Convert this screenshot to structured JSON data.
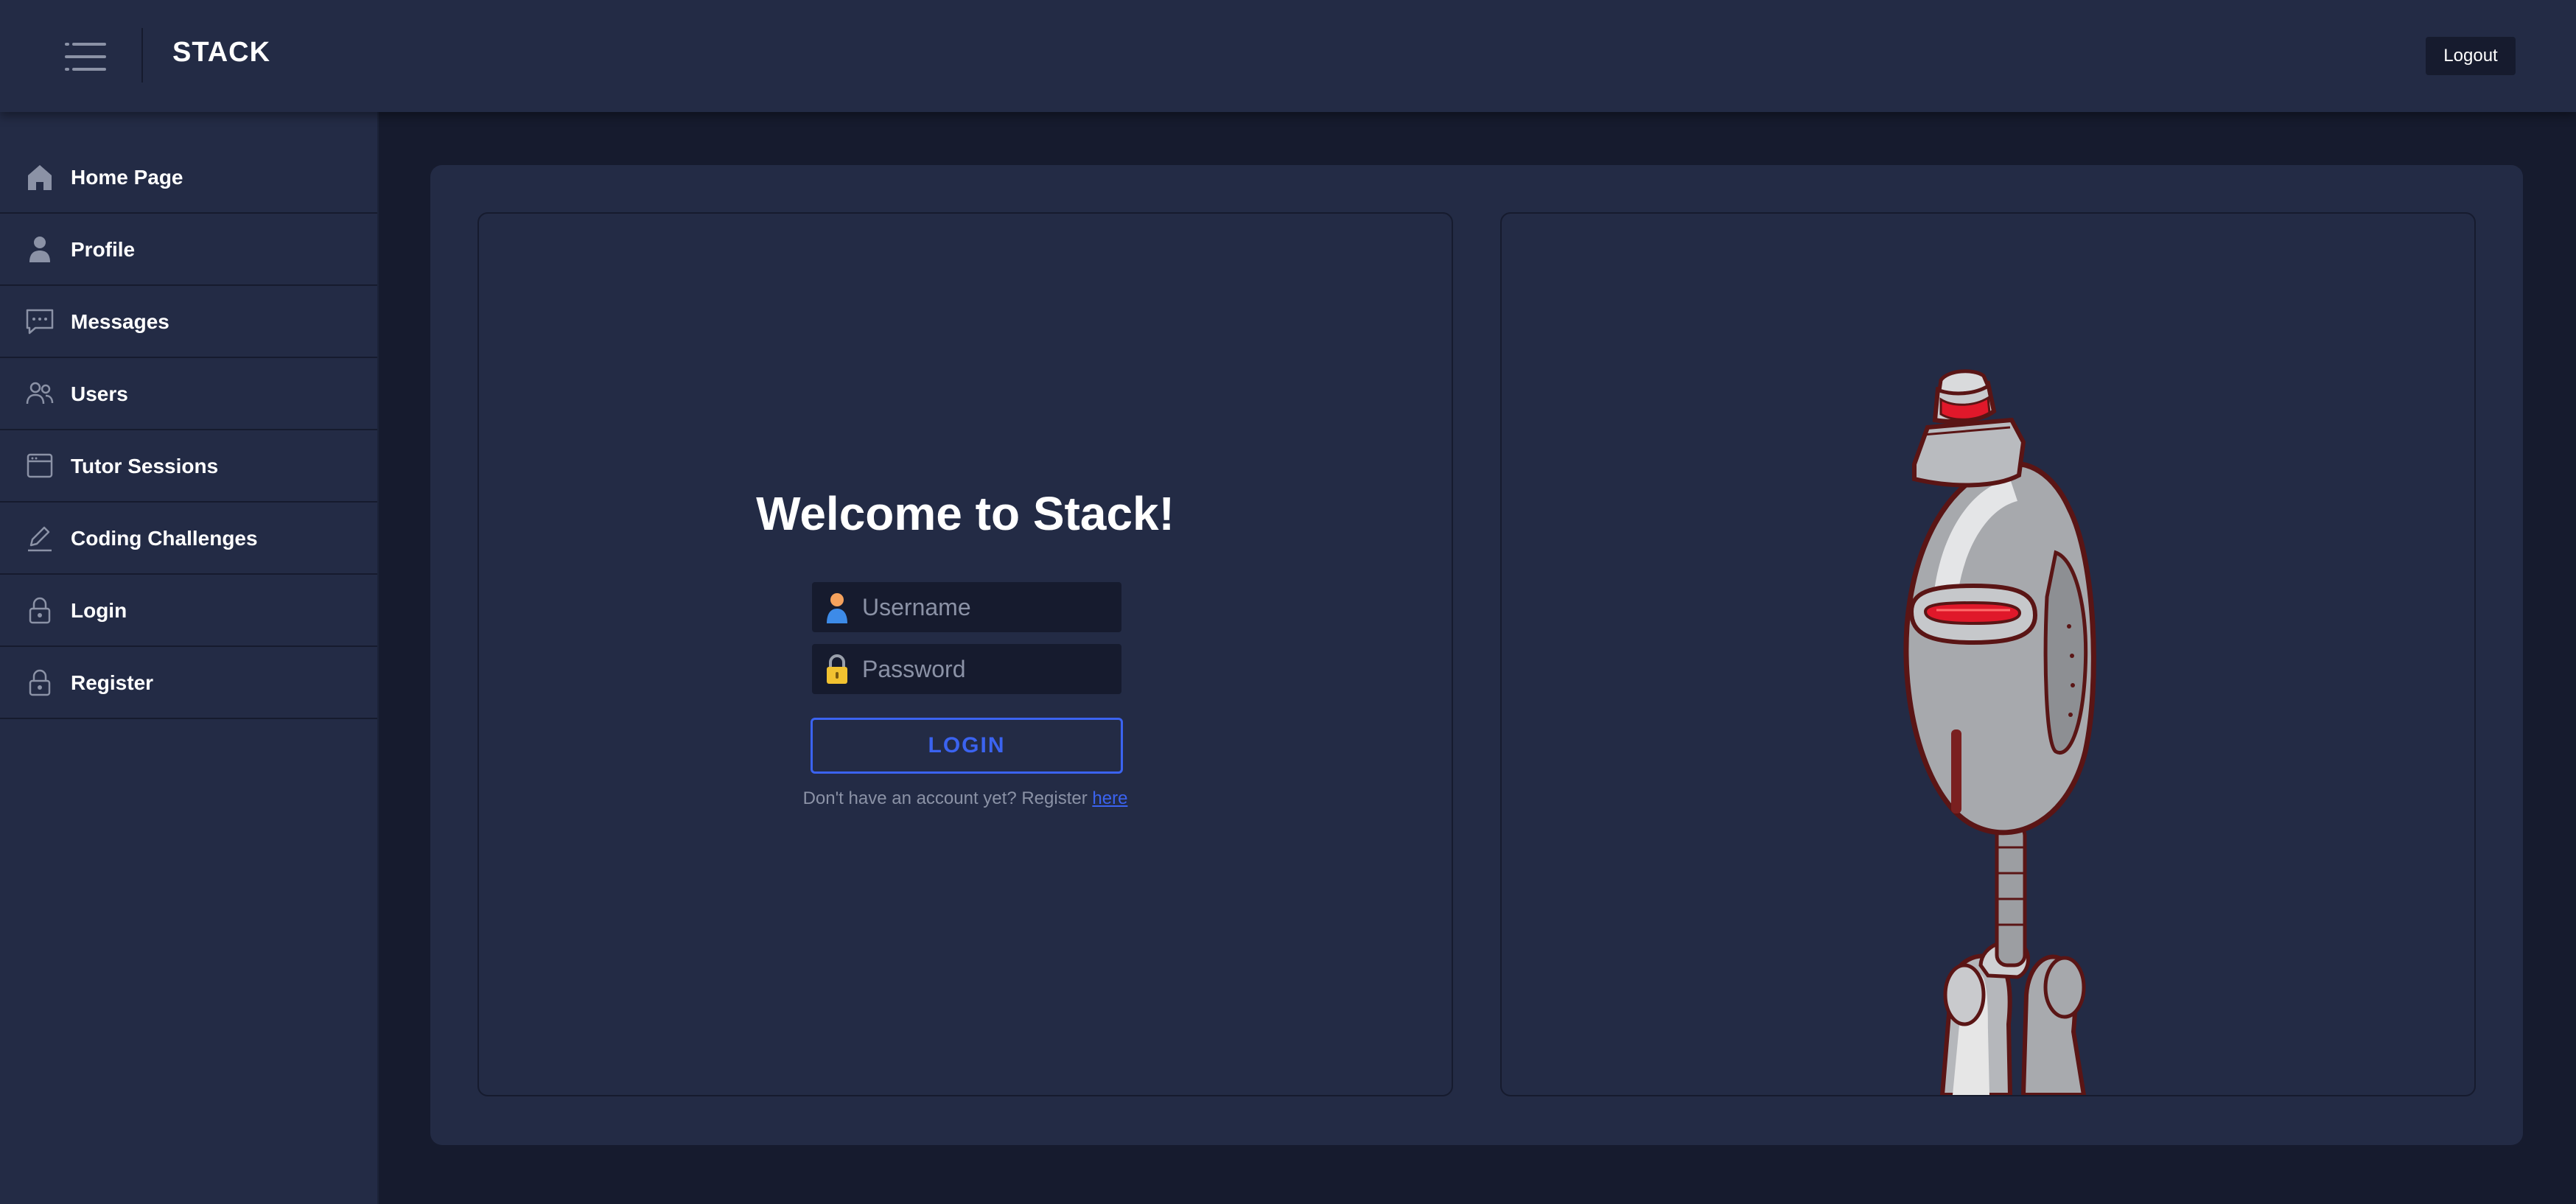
{
  "header": {
    "brand": "STACK",
    "logout_label": "Logout"
  },
  "sidebar": {
    "items": [
      {
        "label": "Home Page",
        "icon": "home-icon"
      },
      {
        "label": "Profile",
        "icon": "user-icon"
      },
      {
        "label": "Messages",
        "icon": "chat-icon"
      },
      {
        "label": "Users",
        "icon": "users-icon"
      },
      {
        "label": "Tutor Sessions",
        "icon": "calendar-window-icon"
      },
      {
        "label": "Coding Challenges",
        "icon": "pencil-icon"
      },
      {
        "label": "Login",
        "icon": "lock-icon"
      },
      {
        "label": "Register",
        "icon": "lock-icon"
      }
    ]
  },
  "login": {
    "title": "Welcome to Stack!",
    "username_placeholder": "Username",
    "username_value": "",
    "password_placeholder": "Password",
    "password_value": "",
    "button_label": "LOGIN",
    "register_prompt": "Don't have an account yet? Register ",
    "register_link": "here"
  },
  "illustration": {
    "subject": "robot-illustration"
  },
  "colors": {
    "background": "#161b2e",
    "panel": "#232b45",
    "accent": "#3b63f0",
    "muted_text": "#8b92a6"
  }
}
